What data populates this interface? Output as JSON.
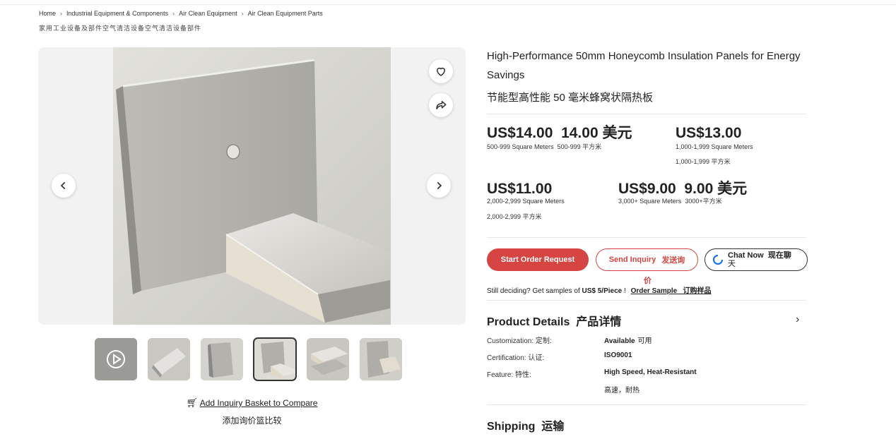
{
  "breadcrumb": {
    "items": [
      "Home",
      "Industrial Equipment & Components",
      "Air Clean Equipment",
      "Air Clean Equipment Parts"
    ],
    "translation": "家用工业设备及部件空气清洁设备空气清洁设备部件"
  },
  "gallery": {
    "thumbnail_count": 6,
    "selected_thumbnail": 4,
    "compare_link": "Add Inquiry Basket to Compare",
    "compare_translation": "添加询价篮比较"
  },
  "product": {
    "title": "High-Performance 50mm Honeycomb Insulation Panels for Energy Savings",
    "title_translation": "节能型高性能 50 毫米蜂窝状隔热板"
  },
  "prices": [
    {
      "price": "US$14.00",
      "price_cn": "14.00 美元",
      "range": "500-999 Square Meters",
      "range_cn": "500-999 平方米"
    },
    {
      "price": "US$13.00",
      "price_cn": "",
      "range": "1,000-1,999 Square Meters",
      "range_cn": "1,000-1,999 平方米"
    },
    {
      "price": "US$11.00",
      "price_cn": "",
      "range": "2,000-2,999 Square Meters",
      "range_cn": "2,000-2,999 平方米"
    },
    {
      "price": "US$9.00",
      "price_cn": "9.00 美元",
      "range": "3,000+ Square Meters",
      "range_cn": "3000+平方米"
    }
  ],
  "actions": {
    "order": "Start Order Request",
    "inquiry": "Send Inquiry",
    "inquiry_cn_a": "发送询",
    "inquiry_cn_b": "价",
    "chat": "Chat Now",
    "chat_cn_a": "现在聊",
    "chat_cn_b": "天"
  },
  "sample": {
    "text": "Still deciding? Get samples of",
    "price": "US$ 5/Piece",
    "bang": "!",
    "link": "Order Sample",
    "link_cn": "订购样品"
  },
  "details": {
    "title": "Product Details",
    "title_cn": "产品详情",
    "rows": [
      {
        "key": "Customization:",
        "key_cn": "定制:",
        "value": "Available",
        "value_cn": "可用"
      },
      {
        "key": "Certification:",
        "key_cn": "认证:",
        "value": "ISO9001",
        "value_cn": ""
      },
      {
        "key": "Feature:",
        "key_cn": "特性:",
        "value": "High Speed, Heat-Resistant",
        "value_cn": "高速，耐热"
      }
    ]
  },
  "shipping": {
    "title": "Shipping",
    "title_cn": "运输"
  },
  "colors": {
    "accent": "#d64541",
    "chat_ring": "#1a73e8"
  }
}
